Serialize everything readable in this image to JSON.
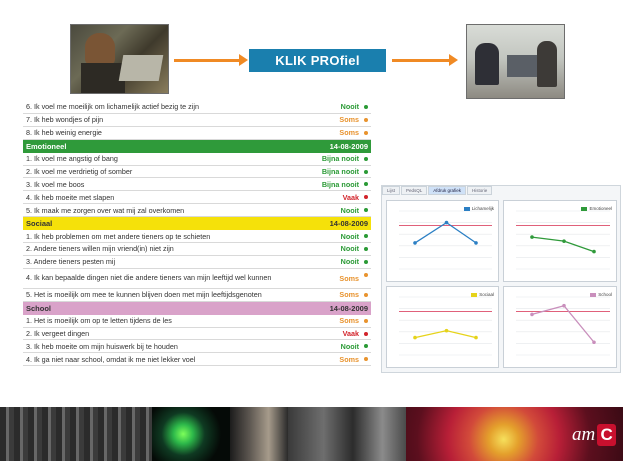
{
  "klik_button": {
    "label": "KLIK PROfiel"
  },
  "questionnaire": {
    "top_rows": [
      {
        "q": "6. Ik voel me moeilijk om lichamelijk actief bezig te zijn",
        "a": "Nooit",
        "cls": "c-nooit",
        "dot": "#2a9a35"
      },
      {
        "q": "7. Ik heb wondjes of pijn",
        "a": "Soms",
        "cls": "c-soms",
        "dot": "#e8932e"
      },
      {
        "q": "8. Ik heb weinig energie",
        "a": "Soms",
        "cls": "c-soms",
        "dot": "#e8932e"
      }
    ],
    "sections": [
      {
        "name": "Emotioneel",
        "date": "14-08-2009",
        "color": "#2f9a3a",
        "text_color": "#ffffff",
        "rows": [
          {
            "q": "1. Ik voel me angstig of bang",
            "a": "Bijna nooit",
            "cls": "c-nooit",
            "dot": "#2a9a35"
          },
          {
            "q": "2. Ik voel me verdrietig of somber",
            "a": "Bijna nooit",
            "cls": "c-nooit",
            "dot": "#2a9a35"
          },
          {
            "q": "3. Ik voel me boos",
            "a": "Bijna nooit",
            "cls": "c-nooit",
            "dot": "#2a9a35"
          },
          {
            "q": "4. Ik heb moeite met slapen",
            "a": "Vaak",
            "cls": "c-vaak",
            "dot": "#d2232a"
          },
          {
            "q": "5. Ik maak me zorgen over wat mij zal overkomen",
            "a": "Nooit",
            "cls": "c-nooit",
            "dot": "#2a9a35"
          }
        ]
      },
      {
        "name": "Sociaal",
        "date": "14-08-2009",
        "color": "#f5e10a",
        "text_color": "#333333",
        "rows": [
          {
            "q": "1. Ik heb problemen om met andere tieners op te schieten",
            "a": "Nooit",
            "cls": "c-nooit",
            "dot": "#2a9a35"
          },
          {
            "q": "2. Andere tieners willen mijn vriend(in) niet zijn",
            "a": "Nooit",
            "cls": "c-nooit",
            "dot": "#2a9a35"
          },
          {
            "q": "3. Andere tieners pesten mij",
            "a": "Nooit",
            "cls": "c-nooit",
            "dot": "#2a9a35"
          },
          {
            "q": "4. Ik kan bepaalde dingen niet die andere tieners van mijn leeftijd wel kunnen",
            "a": "Soms",
            "cls": "c-soms",
            "dot": "#e8932e",
            "tall": true
          },
          {
            "q": "5. Het is moeilijk om mee te kunnen blijven doen met mijn leeftijdsgenoten",
            "a": "Soms",
            "cls": "c-soms",
            "dot": "#e8932e"
          }
        ]
      },
      {
        "name": "School",
        "date": "14-08-2009",
        "color": "#d9a2c9",
        "text_color": "#333333",
        "rows": [
          {
            "q": "1. Het is moeilijk om op te letten tijdens de les",
            "a": "Soms",
            "cls": "c-soms",
            "dot": "#e8932e"
          },
          {
            "q": "2. Ik vergeet dingen",
            "a": "Vaak",
            "cls": "c-vaak",
            "dot": "#d2232a"
          },
          {
            "q": "3. Ik heb moeite om mijn huiswerk bij te houden",
            "a": "Nooit",
            "cls": "c-nooit",
            "dot": "#2a9a35"
          },
          {
            "q": "4. Ik ga niet naar school, omdat ik me niet lekker voel",
            "a": "Soms",
            "cls": "c-soms",
            "dot": "#e8932e"
          }
        ]
      }
    ]
  },
  "chart_panel": {
    "tabs": [
      "Lijst",
      "PedsQL",
      "Afdruk grafiek",
      "Historie"
    ],
    "charts": [
      {
        "legend": "Lichamelijk",
        "color": "#2b7fc4",
        "points": [
          0.55,
          0.2,
          0.55
        ]
      },
      {
        "legend": "Emotioneel",
        "color": "#2f9a3a",
        "points": [
          0.45,
          0.52,
          0.7
        ]
      },
      {
        "legend": "Sociaal",
        "color": "#e6d31a",
        "points": [
          0.7,
          0.58,
          0.7
        ]
      },
      {
        "legend": "School",
        "color": "#c98fbc",
        "points": [
          0.3,
          0.15,
          0.78
        ]
      }
    ]
  },
  "logo": {
    "text": "am",
    "mark": "C"
  }
}
